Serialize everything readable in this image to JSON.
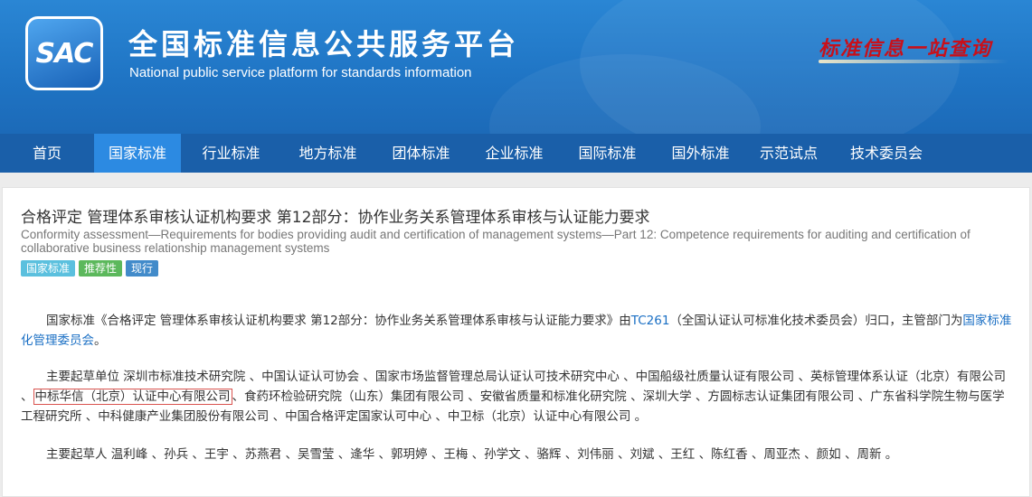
{
  "header": {
    "logo_text": "SAC",
    "title_cn": "全国标准信息公共服务平台",
    "title_en": "National public service platform  for standards information",
    "slogan": "标准信息一站查询"
  },
  "nav": {
    "items": [
      {
        "label": "首页"
      },
      {
        "label": "国家标准"
      },
      {
        "label": "行业标准"
      },
      {
        "label": "地方标准"
      },
      {
        "label": "团体标准"
      },
      {
        "label": "企业标准"
      },
      {
        "label": "国际标准"
      },
      {
        "label": "国外标准"
      },
      {
        "label": "示范试点"
      },
      {
        "label": "技术委员会"
      }
    ],
    "active_index": 1,
    "colors": {
      "bar": "#1a5fa9",
      "active": "#2c8ae2"
    }
  },
  "standard": {
    "title_cn": "合格评定 管理体系审核认证机构要求 第12部分：协作业务关系管理体系审核与认证能力要求",
    "title_en": "Conformity assessment—Requirements for bodies providing audit and certification of management systems—Part 12: Competence requirements for auditing and certification of collaborative business relationship management systems",
    "badges": [
      "国家标准",
      "推荐性",
      "现行"
    ]
  },
  "paragraph1": {
    "prefix": "国家标准《合格评定 管理体系审核认证机构要求 第12部分：协作业务关系管理体系审核与认证能力要求》由",
    "tc_link": "TC261",
    "middle": "（全国认证认可标准化技术委员会）归口，主管部门为",
    "dept_link": "国家标准化管理委员会",
    "suffix": "。"
  },
  "paragraph2": {
    "before_boxed": "主要起草单位 深圳市标准技术研究院 、中国认证认可协会 、国家市场监督管理总局认证认可技术研究中心 、中国船级社质量认证有限公司 、英标管理体系认证（北京）有限公司 、",
    "boxed": "中标华信（北京）认证中心有限公司",
    "after_boxed": "、食药环检验研究院（山东）集团有限公司 、安徽省质量和标准化研究院 、深圳大学 、方圆标志认证集团有限公司 、广东省科学院生物与医学工程研究所 、中科健康产业集团股份有限公司 、中国合格评定国家认可中心 、中卫标（北京）认证中心有限公司 。"
  },
  "paragraph3": {
    "text": "主要起草人 温利峰 、孙兵 、王宇 、苏燕君 、吴雪莹 、逄华 、郭玥婷 、王梅 、孙学文 、骆辉 、刘伟丽 、刘斌 、王红 、陈红香 、周亚杰 、颜如 、周新 。"
  }
}
